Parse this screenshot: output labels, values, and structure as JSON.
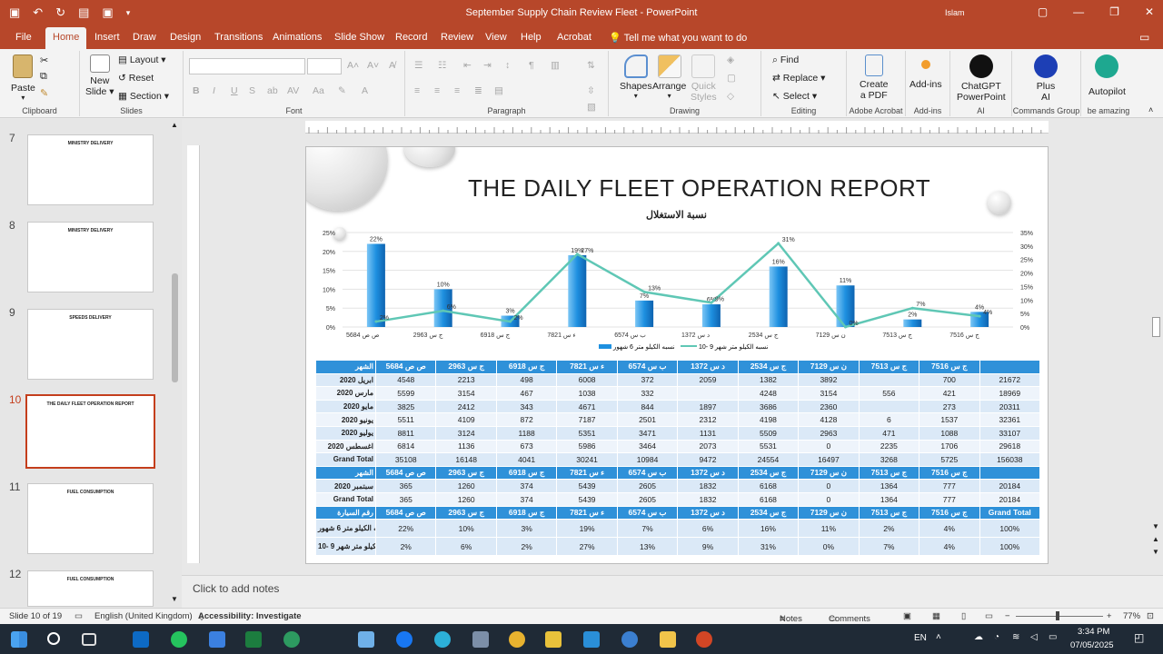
{
  "window": {
    "title": "September Supply Chain Review Fleet  -  PowerPoint",
    "user": "Islam"
  },
  "tabs": [
    "File",
    "Home",
    "Insert",
    "Draw",
    "Design",
    "Transitions",
    "Animations",
    "Slide Show",
    "Record",
    "Review",
    "View",
    "Help",
    "Acrobat"
  ],
  "tell_me": "Tell me what you want to do",
  "ribbon": {
    "clipboard": {
      "paste": "Paste",
      "label": "Clipboard"
    },
    "slides": {
      "new_slide": "New",
      "new_slide2": "Slide",
      "layout": "Layout",
      "reset": "Reset",
      "section": "Section",
      "label": "Slides"
    },
    "font": {
      "label": "Font"
    },
    "paragraph": {
      "label": "Paragraph"
    },
    "drawing": {
      "shapes": "Shapes",
      "arrange": "Arrange",
      "quick1": "Quick",
      "quick2": "Styles",
      "label": "Drawing"
    },
    "editing": {
      "find": "Find",
      "replace": "Replace",
      "select": "Select",
      "label": "Editing"
    },
    "acrobat": {
      "create1": "Create",
      "create2": "a PDF",
      "label": "Adobe Acrobat"
    },
    "addins": {
      "name": "Add-ins",
      "label": "Add-ins"
    },
    "ai": {
      "name1": "ChatGPT",
      "name2": "PowerPoint",
      "label": "AI"
    },
    "commands": {
      "name1": "Plus",
      "name2": "AI",
      "label": "Commands Group"
    },
    "autopilot": {
      "name": "Autopilot",
      "label": "be amazing"
    }
  },
  "thumbnails": [
    {
      "num": "7",
      "title": "MINISTRY DELIVERY"
    },
    {
      "num": "8",
      "title": "MINISTRY DELIVERY"
    },
    {
      "num": "9",
      "title": "SPEEDS DELIVERY"
    },
    {
      "num": "10",
      "title": "THE DAILY FLEET OPERATION REPORT"
    },
    {
      "num": "11",
      "title": "FUEL CONSUMPTION"
    },
    {
      "num": "12",
      "title": "FUEL CONSUMPTION"
    }
  ],
  "slide": {
    "title": "THE DAILY FLEET OPERATION REPORT",
    "subtitle": "نسبة الاستغلال",
    "legend_bar": "نسبه الكيلو متر 6 شهور",
    "legend_line": "نسبه الكيلو متر شهر 9 -10",
    "table": {
      "header": [
        "5684 ص ص",
        "2963 ج س",
        "6918 ج س",
        "7821 ء س",
        "6574 ب س",
        "1372 د س",
        "2534 ج س",
        "7129 ن س",
        "7513 ج س",
        "7516 ج س",
        ""
      ],
      "header_label": "الشهر",
      "months": [
        {
          "label": "ابريل 2020",
          "vals": [
            "4548",
            "2213",
            "498",
            "6008",
            "372",
            "2059",
            "1382",
            "3892",
            "",
            "700",
            "21672"
          ]
        },
        {
          "label": "مارس 2020",
          "vals": [
            "5599",
            "3154",
            "467",
            "1038",
            "332",
            "",
            "4248",
            "3154",
            "556",
            "421",
            "18969"
          ]
        },
        {
          "label": "مايو 2020",
          "vals": [
            "3825",
            "2412",
            "343",
            "4671",
            "844",
            "1897",
            "3686",
            "2360",
            "",
            "273",
            "20311"
          ]
        },
        {
          "label": "يونيو 2020",
          "vals": [
            "5511",
            "4109",
            "872",
            "7187",
            "2501",
            "2312",
            "4198",
            "4128",
            "6",
            "1537",
            "32361"
          ]
        },
        {
          "label": "يوليو 2020",
          "vals": [
            "8811",
            "3124",
            "1188",
            "5351",
            "3471",
            "1131",
            "5509",
            "2963",
            "471",
            "1088",
            "33107"
          ]
        },
        {
          "label": "اغسطس 2020",
          "vals": [
            "6814",
            "1136",
            "673",
            "5986",
            "3464",
            "2073",
            "5531",
            "0",
            "2235",
            "1706",
            "29618"
          ]
        },
        {
          "label": "Grand Total",
          "vals": [
            "35108",
            "16148",
            "4041",
            "30241",
            "10984",
            "9472",
            "24554",
            "16497",
            "3268",
            "5725",
            "156038"
          ]
        }
      ],
      "sep_rows": [
        {
          "label": "سبتمبر 2020",
          "vals": [
            "365",
            "1260",
            "374",
            "5439",
            "2605",
            "1832",
            "6168",
            "0",
            "1364",
            "777",
            "20184"
          ]
        },
        {
          "label": "Grand Total",
          "vals": [
            "365",
            "1260",
            "374",
            "5439",
            "2605",
            "1832",
            "6168",
            "0",
            "1364",
            "777",
            "20184"
          ]
        }
      ],
      "header3_label": "رقم السيارة",
      "header3_last": "Grand Total",
      "pct_rows": [
        {
          "label": "نسبه الكيلو متر 6 شهور",
          "vals": [
            "22%",
            "10%",
            "3%",
            "19%",
            "7%",
            "6%",
            "16%",
            "11%",
            "2%",
            "4%",
            "100%"
          ]
        },
        {
          "label": "نسبه الكيلو متر شهر 9 -10",
          "vals": [
            "2%",
            "6%",
            "2%",
            "27%",
            "13%",
            "9%",
            "31%",
            "0%",
            "7%",
            "4%",
            "100%"
          ]
        }
      ]
    }
  },
  "chart_data": {
    "type": "bar",
    "categories": [
      "5684 ص ص",
      "2963 ج س",
      "6918 ج س",
      "7821 ء س",
      "6574 ب س",
      "1372 د س",
      "2534 ج س",
      "7129 ن س",
      "7513 ج س",
      "7516 ج س"
    ],
    "series": [
      {
        "name": "نسبه الكيلو متر 6 شهور",
        "type": "bar",
        "values": [
          22,
          10,
          3,
          19,
          7,
          6,
          16,
          11,
          2,
          4
        ],
        "labels": [
          "22%",
          "10%",
          "3%",
          "19%",
          "7%",
          "6%",
          "16%",
          "11%",
          "2%",
          "4%"
        ]
      },
      {
        "name": "نسبه الكيلو متر شهر 9 -10",
        "type": "line",
        "values": [
          2,
          6,
          2,
          27,
          13,
          9,
          31,
          0,
          7,
          4
        ],
        "labels": [
          "2%",
          "6%",
          "2%",
          "27%",
          "13%",
          "9%",
          "31%",
          "0%",
          "7%",
          "4%"
        ]
      }
    ],
    "y_left_ticks": [
      "0%",
      "5%",
      "10%",
      "15%",
      "20%",
      "25%"
    ],
    "y_right_ticks": [
      "0%",
      "5%",
      "10%",
      "15%",
      "20%",
      "25%",
      "30%",
      "35%"
    ],
    "ylim_left": [
      0,
      25
    ],
    "ylim_right": [
      0,
      35
    ],
    "legend": "bottom",
    "grid": true,
    "colors": {
      "bar": "#1e90e0",
      "line": "#5fc7b5"
    }
  },
  "notes": "Click to add notes",
  "status": {
    "slide": "Slide 10 of 19",
    "lang": "English (United Kingdom)",
    "access": "Accessibility: Investigate",
    "notes": "Notes",
    "comments": "Comments",
    "zoom": "77%"
  },
  "taskbar": {
    "lang": "EN",
    "time": "3:34 PM",
    "date": "07/05/2025"
  }
}
